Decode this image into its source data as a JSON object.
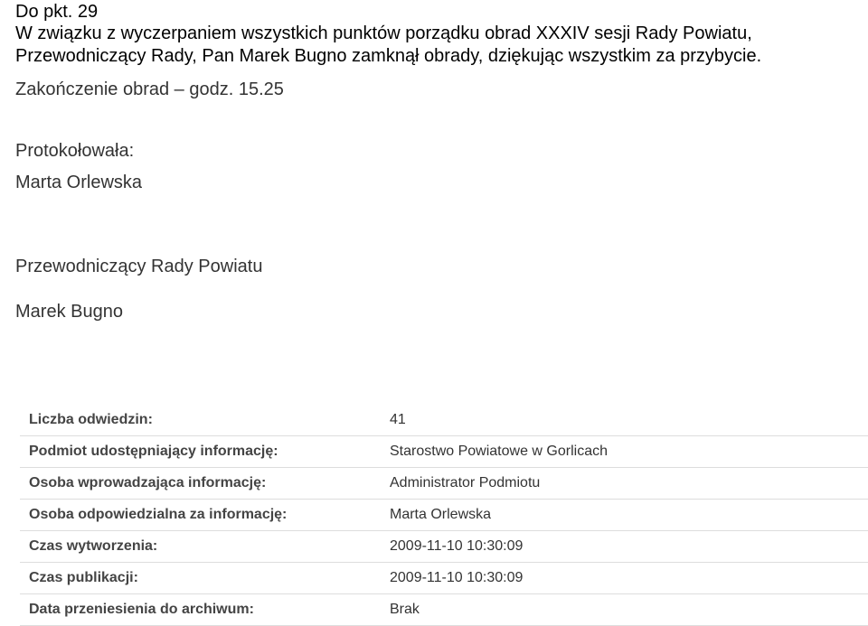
{
  "document": {
    "point": "Do pkt. 29",
    "body_line1": "W związku z wyczerpaniem wszystkich punktów porządku obrad XXXIV sesji Rady Powiatu,",
    "body_line2": "Przewodniczący Rady, Pan Marek Bugno zamknął obrady, dziękując wszystkim za przybycie.",
    "closing": "Zakończenie obrad – godz. 15.25",
    "recorded_by_label": "Protokołowała:",
    "recorded_by_name": "Marta Orlewska",
    "chair_title": "Przewodniczący Rady Powiatu",
    "chair_name": "Marek Bugno"
  },
  "metadata": {
    "rows": [
      {
        "label": "Liczba odwiedzin:",
        "value": "41"
      },
      {
        "label": "Podmiot udostępniający informację:",
        "value": "Starostwo Powiatowe w Gorlicach"
      },
      {
        "label": "Osoba wprowadzająca informację:",
        "value": "Administrator Podmiotu"
      },
      {
        "label": "Osoba odpowiedzialna za informację:",
        "value": "Marta Orlewska"
      },
      {
        "label": "Czas wytworzenia:",
        "value": "2009-11-10 10:30:09"
      },
      {
        "label": "Czas publikacji:",
        "value": "2009-11-10 10:30:09"
      },
      {
        "label": "Data przeniesienia do archiwum:",
        "value": "Brak"
      }
    ]
  }
}
